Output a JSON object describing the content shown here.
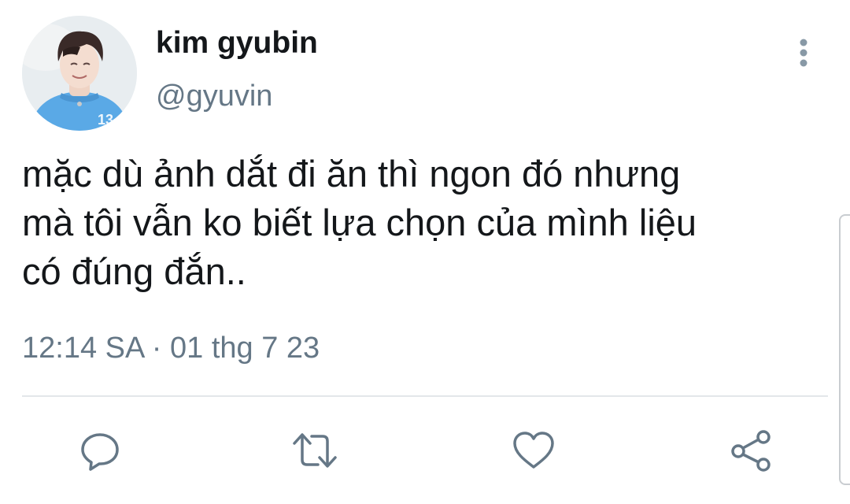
{
  "user": {
    "display_name": "kim gyubin",
    "handle": "@gyuvin",
    "avatar_jersey_number": "13"
  },
  "tweet": {
    "lines": [
      "mặc dù ảnh dắt đi ăn thì ngon đó nhưng",
      "mà tôi vẫn ko biết lựa chọn của mình liệu",
      "có đúng đắn.."
    ],
    "timestamp": "12:14 SA · 01 thg 7 23"
  },
  "actions": [
    {
      "name": "reply",
      "icon": "comment-icon"
    },
    {
      "name": "retweet",
      "icon": "retweet-icon"
    },
    {
      "name": "like",
      "icon": "heart-icon"
    },
    {
      "name": "share",
      "icon": "share-icon"
    }
  ],
  "menu": {
    "icon": "more-vertical-icon"
  },
  "colors": {
    "text": "#14171a",
    "secondary": "#657786",
    "icon": "#657786",
    "divider": "#e3e7ea",
    "avatar_shirt": "#5aa9e6"
  }
}
